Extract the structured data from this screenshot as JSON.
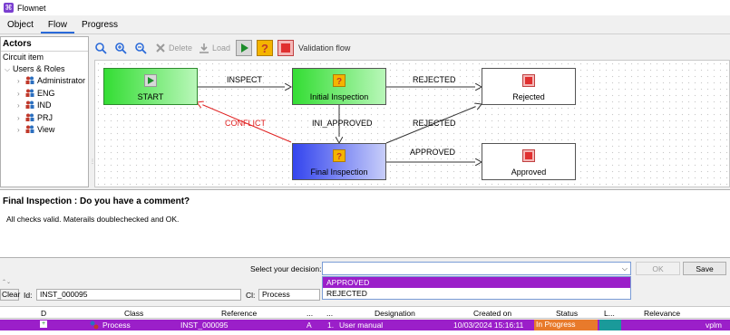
{
  "window": {
    "title": "Flownet"
  },
  "tabs": [
    {
      "label": "Object"
    },
    {
      "label": "Flow"
    },
    {
      "label": "Progress"
    }
  ],
  "actors": {
    "title": "Actors",
    "root": "Circuit item",
    "group": "Users & Roles",
    "roles": [
      "Administrator",
      "ENG",
      "IND",
      "PRJ",
      "View"
    ]
  },
  "toolbar": {
    "delete_label": "Delete",
    "load_label": "Load",
    "flow_name": "Validation flow"
  },
  "flow": {
    "nodes": {
      "start": "START",
      "initial": "Initial Inspection",
      "rejected": "Rejected",
      "final": "Final Inspection",
      "approved": "Approved"
    },
    "edges": {
      "inspect": "INSPECT",
      "rejected1": "REJECTED",
      "ini_approved": "INI_APPROVED",
      "rejected2": "REJECTED",
      "conflict": "CONFLICT",
      "approved": "APPROVED"
    },
    "colors": {
      "start": "#33dd33",
      "final": "#3344ee",
      "conflict": "#e02020",
      "stop": "#e03030"
    }
  },
  "comment": {
    "heading": "Final Inspection : Do you have a comment?",
    "text": "All checks valid. Materails doublechecked and OK."
  },
  "decision": {
    "label": "Select your decision:",
    "value": "",
    "options": [
      "APPROVED",
      "REJECTED"
    ],
    "ok_label": "OK",
    "save_label": "Save"
  },
  "filter": {
    "clear_label": "Clear",
    "id_label": "Id:",
    "id_value": "INST_000095",
    "cl_label": "Cl:",
    "cl_value": "Process"
  },
  "grid": {
    "columns": [
      "D",
      "Class",
      "Reference",
      "...",
      "...",
      "Designation",
      "Created on",
      "Status",
      "L...",
      "Relevance"
    ],
    "rows": [
      {
        "class": "Process",
        "reference": "INST_000095",
        "col4": "A",
        "col5": "1.",
        "designation": "User manual",
        "created_on": "10/03/2024 15:16:11",
        "status": "In Progress",
        "extra": "vplm"
      }
    ]
  }
}
